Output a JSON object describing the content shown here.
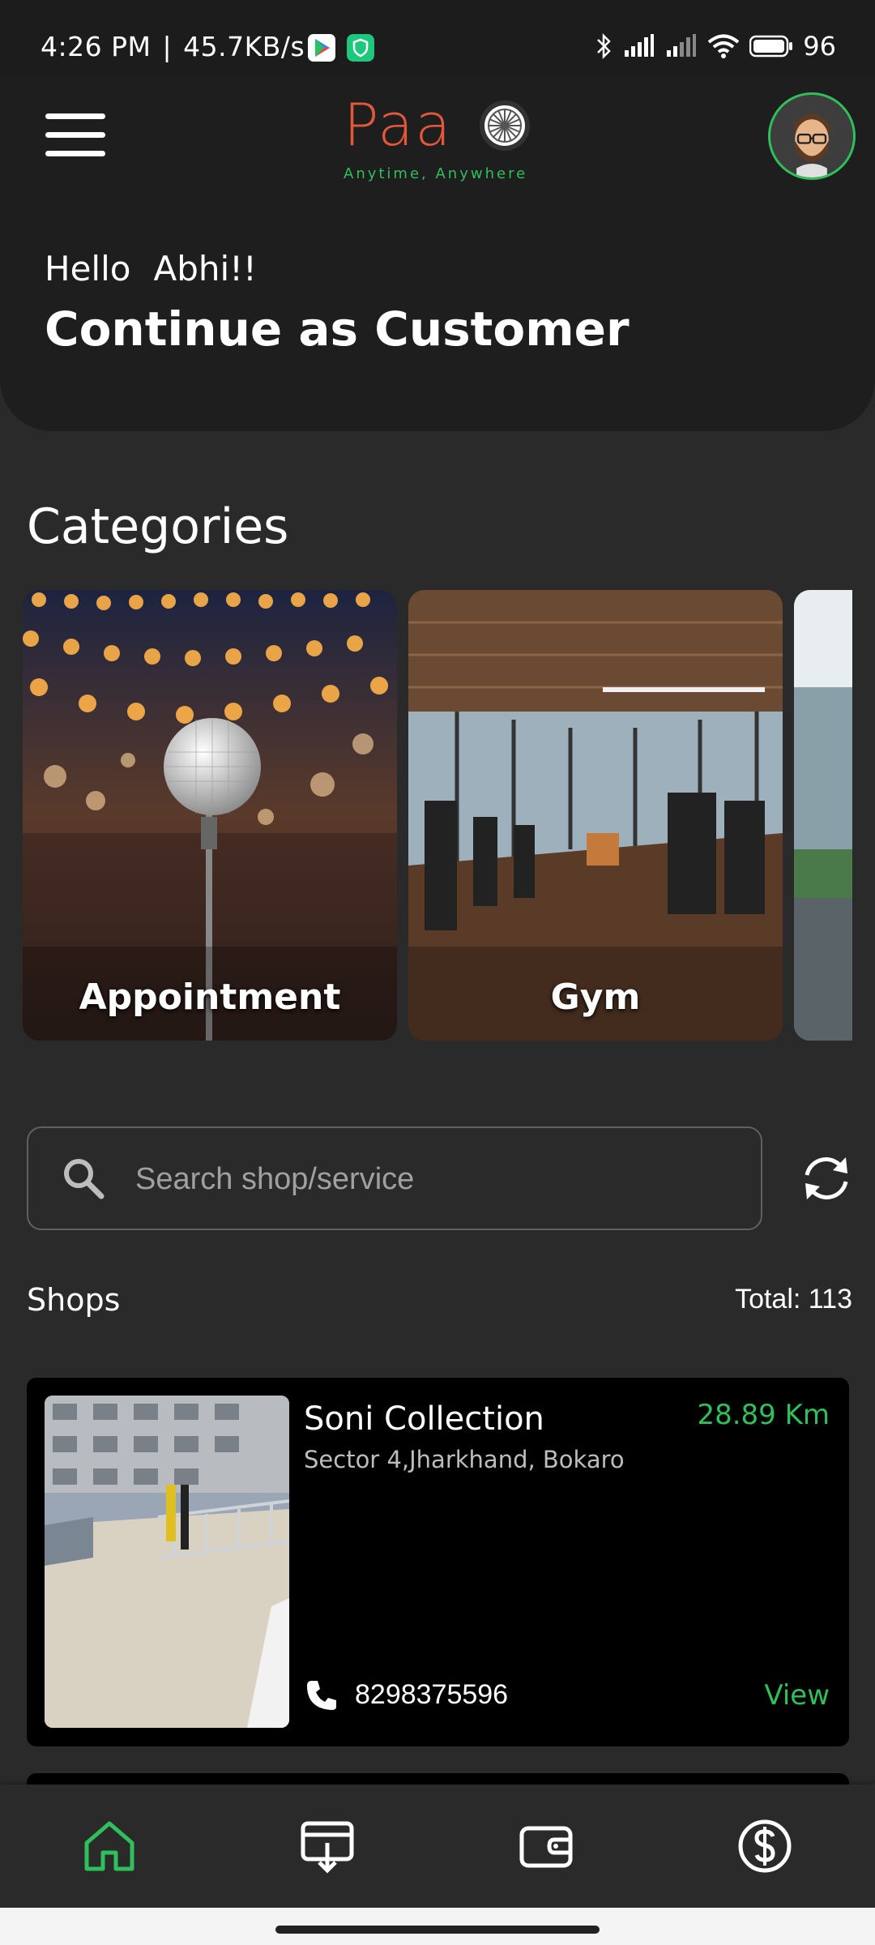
{
  "status_bar": {
    "time": "4:26 PM",
    "speed": "45.7KB/s",
    "battery": "96"
  },
  "header": {
    "logo_text": "Paa",
    "logo_tagline": "Anytime, Anywhere",
    "greeting": "Hello",
    "user_name": "Abhi!!",
    "title": "Continue as Customer"
  },
  "categories": {
    "title": "Categories",
    "items": [
      {
        "label": "Appointment"
      },
      {
        "label": "Gym"
      },
      {
        "label": ""
      }
    ]
  },
  "search": {
    "placeholder": "Search shop/service"
  },
  "shops": {
    "label": "Shops",
    "total": "Total: 113",
    "items": [
      {
        "name": "Soni Collection",
        "address": "Sector 4,Jharkhand, Bokaro",
        "distance": "28.89 Km",
        "phone": "8298375596",
        "action": "View"
      }
    ]
  },
  "bottom_nav": {
    "items": [
      "home-icon",
      "billing-icon",
      "wallet-icon",
      "dollar-icon"
    ],
    "active_color": "#2fbf5b"
  },
  "colors": {
    "accent_green": "#2fbf5b",
    "logo_red": "#e3573b",
    "background": "#2a2a2a"
  }
}
